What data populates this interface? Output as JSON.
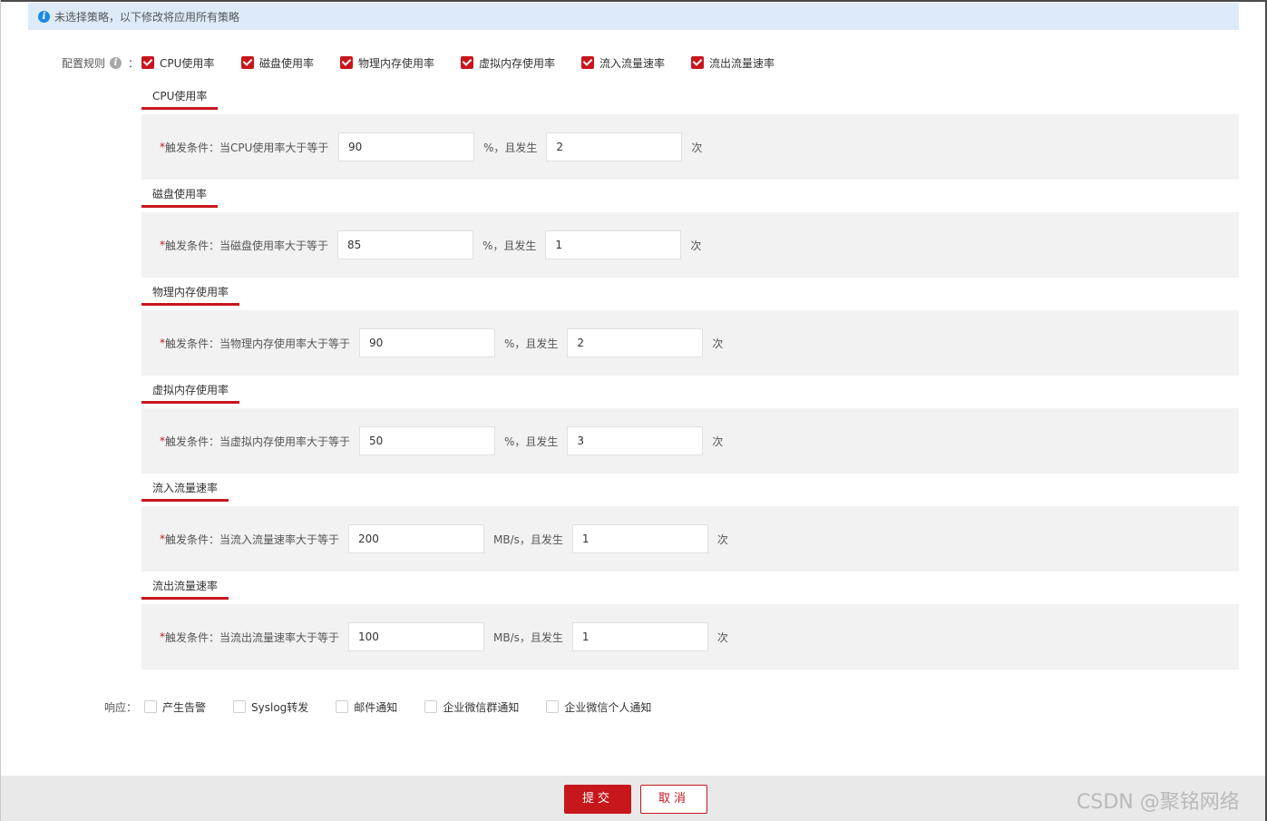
{
  "info_bar": {
    "text": "未选择策略，以下修改将应用所有策略"
  },
  "rules": {
    "label": "配置规则",
    "colon": "：",
    "options": [
      {
        "label": "CPU使用率",
        "checked": true
      },
      {
        "label": "磁盘使用率",
        "checked": true
      },
      {
        "label": "物理内存使用率",
        "checked": true
      },
      {
        "label": "虚拟内存使用率",
        "checked": true
      },
      {
        "label": "流入流量速率",
        "checked": true
      },
      {
        "label": "流出流量速率",
        "checked": true
      }
    ]
  },
  "sections": [
    {
      "title": "CPU使用率",
      "required_mark": "*",
      "condition_label": "触发条件：当CPU使用率大于等于",
      "threshold": "90",
      "unit": "%，且发生",
      "count": "2",
      "count_unit": "次"
    },
    {
      "title": "磁盘使用率",
      "required_mark": "*",
      "condition_label": "触发条件：当磁盘使用率大于等于",
      "threshold": "85",
      "unit": "%，且发生",
      "count": "1",
      "count_unit": "次"
    },
    {
      "title": "物理内存使用率",
      "required_mark": "*",
      "condition_label": "触发条件：当物理内存使用率大于等于",
      "threshold": "90",
      "unit": "%，且发生",
      "count": "2",
      "count_unit": "次"
    },
    {
      "title": "虚拟内存使用率",
      "required_mark": "*",
      "condition_label": "触发条件：当虚拟内存使用率大于等于",
      "threshold": "50",
      "unit": "%，且发生",
      "count": "3",
      "count_unit": "次"
    },
    {
      "title": "流入流量速率",
      "required_mark": "*",
      "condition_label": "触发条件：当流入流量速率大于等于",
      "threshold": "200",
      "unit": "MB/s，且发生",
      "count": "1",
      "count_unit": "次"
    },
    {
      "title": "流出流量速率",
      "required_mark": "*",
      "condition_label": "触发条件：当流出流量速率大于等于",
      "threshold": "100",
      "unit": "MB/s，且发生",
      "count": "1",
      "count_unit": "次"
    }
  ],
  "response": {
    "label": "响应：",
    "options": [
      {
        "label": "产生告警",
        "checked": false
      },
      {
        "label": "Syslog转发",
        "checked": false
      },
      {
        "label": "邮件通知",
        "checked": false
      },
      {
        "label": "企业微信群通知",
        "checked": false
      },
      {
        "label": "企业微信个人通知",
        "checked": false
      }
    ]
  },
  "buttons": {
    "submit": "提交",
    "cancel": "取消"
  },
  "watermark": "CSDN @聚铭网络",
  "colors": {
    "accent": "#c8161d",
    "info_bg": "#ddeaf8",
    "info_icon": "#1e88e5",
    "panel_bg": "#f2f2f2"
  },
  "icons": {
    "info": "info-icon",
    "help": "help-icon"
  }
}
